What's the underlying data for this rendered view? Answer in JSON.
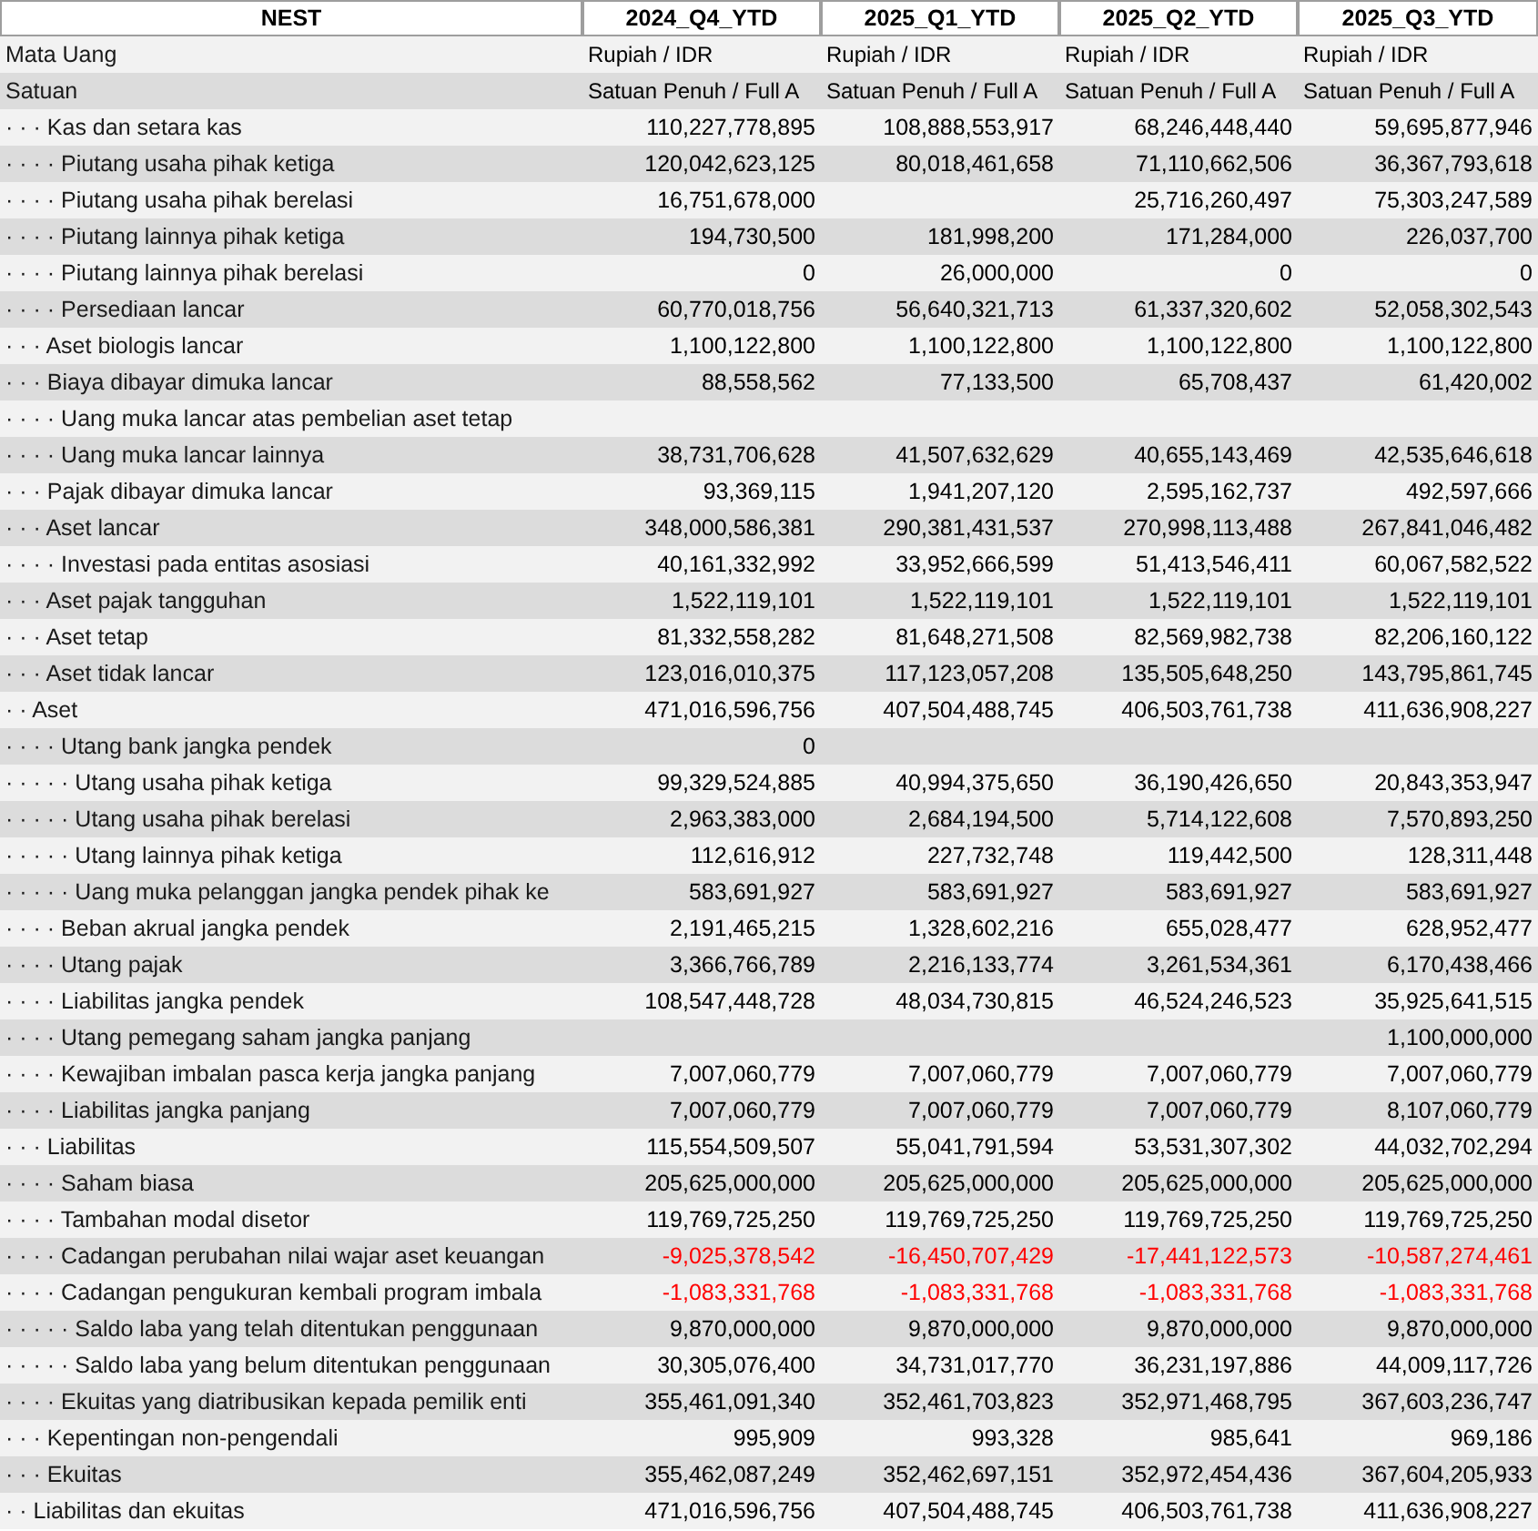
{
  "table": {
    "columns": [
      "NEST",
      "2024_Q4_YTD",
      "2025_Q1_YTD",
      "2025_Q2_YTD",
      "2025_Q3_YTD"
    ],
    "rows": [
      {
        "label": "Mata Uang",
        "kind": "meta",
        "q4_2024": "Rupiah / IDR",
        "q1_2025": "Rupiah / IDR",
        "q2_2025": "Rupiah / IDR",
        "q3_2025": "Rupiah / IDR"
      },
      {
        "label": "Satuan",
        "kind": "meta",
        "q4_2024": "Satuan Penuh / Full A",
        "q1_2025": "Satuan Penuh / Full A",
        "q2_2025": "Satuan Penuh / Full A",
        "q3_2025": "Satuan Penuh / Full A"
      },
      {
        "label": "· · · Kas dan setara kas",
        "negative": false,
        "kind": "num",
        "q4_2024": "110,227,778,895",
        "q1_2025": "108,888,553,917",
        "q2_2025": "68,246,448,440",
        "q3_2025": "59,695,877,946"
      },
      {
        "label": "· · · · Piutang usaha pihak ketiga",
        "negative": false,
        "kind": "num",
        "q4_2024": "120,042,623,125",
        "q1_2025": "80,018,461,658",
        "q2_2025": "71,110,662,506",
        "q3_2025": "36,367,793,618"
      },
      {
        "label": "· · · · Piutang usaha pihak berelasi",
        "negative": false,
        "kind": "num",
        "q4_2024": "16,751,678,000",
        "q2_2025": "25,716,260,497",
        "q3_2025": "75,303,247,589"
      },
      {
        "label": "· · · · Piutang lainnya pihak ketiga",
        "negative": false,
        "kind": "num",
        "q4_2024": "194,730,500",
        "q1_2025": "181,998,200",
        "q2_2025": "171,284,000",
        "q3_2025": "226,037,700"
      },
      {
        "label": "· · · · Piutang lainnya pihak berelasi",
        "negative": false,
        "kind": "num",
        "q4_2024": "0",
        "q1_2025": "26,000,000",
        "q2_2025": "0",
        "q3_2025": "0"
      },
      {
        "label": "· · · · Persediaan lancar",
        "negative": false,
        "kind": "num",
        "q4_2024": "60,770,018,756",
        "q1_2025": "56,640,321,713",
        "q2_2025": "61,337,320,602",
        "q3_2025": "52,058,302,543"
      },
      {
        "label": "· · · Aset biologis lancar",
        "negative": false,
        "kind": "num",
        "q4_2024": "1,100,122,800",
        "q1_2025": "1,100,122,800",
        "q2_2025": "1,100,122,800",
        "q3_2025": "1,100,122,800"
      },
      {
        "label": "· · · Biaya dibayar dimuka lancar",
        "negative": false,
        "kind": "num",
        "q4_2024": "88,558,562",
        "q1_2025": "77,133,500",
        "q2_2025": "65,708,437",
        "q3_2025": "61,420,002"
      },
      {
        "label": "· · · · Uang muka lancar atas pembelian aset tetap",
        "kind": "num"
      },
      {
        "label": "· · · · Uang muka lancar lainnya",
        "negative": false,
        "kind": "num",
        "q4_2024": "38,731,706,628",
        "q1_2025": "41,507,632,629",
        "q2_2025": "40,655,143,469",
        "q3_2025": "42,535,646,618"
      },
      {
        "label": "· · · Pajak dibayar dimuka lancar",
        "negative": false,
        "kind": "num",
        "q4_2024": "93,369,115",
        "q1_2025": "1,941,207,120",
        "q2_2025": "2,595,162,737",
        "q3_2025": "492,597,666"
      },
      {
        "label": "· · · Aset lancar",
        "negative": false,
        "kind": "num",
        "q4_2024": "348,000,586,381",
        "q1_2025": "290,381,431,537",
        "q2_2025": "270,998,113,488",
        "q3_2025": "267,841,046,482"
      },
      {
        "label": "· · · · Investasi pada entitas asosiasi",
        "negative": false,
        "kind": "num",
        "q4_2024": "40,161,332,992",
        "q1_2025": "33,952,666,599",
        "q2_2025": "51,413,546,411",
        "q3_2025": "60,067,582,522"
      },
      {
        "label": "· · · Aset pajak tangguhan",
        "negative": false,
        "kind": "num",
        "q4_2024": "1,522,119,101",
        "q1_2025": "1,522,119,101",
        "q2_2025": "1,522,119,101",
        "q3_2025": "1,522,119,101"
      },
      {
        "label": "· · · Aset tetap",
        "negative": false,
        "kind": "num",
        "q4_2024": "81,332,558,282",
        "q1_2025": "81,648,271,508",
        "q2_2025": "82,569,982,738",
        "q3_2025": "82,206,160,122"
      },
      {
        "label": "· · · Aset tidak lancar",
        "negative": false,
        "kind": "num",
        "q4_2024": "123,016,010,375",
        "q1_2025": "117,123,057,208",
        "q2_2025": "135,505,648,250",
        "q3_2025": "143,795,861,745"
      },
      {
        "label": "· · Aset",
        "negative": false,
        "kind": "num",
        "q4_2024": "471,016,596,756",
        "q1_2025": "407,504,488,745",
        "q2_2025": "406,503,761,738",
        "q3_2025": "411,636,908,227"
      },
      {
        "label": "· · · · Utang bank jangka pendek",
        "negative": false,
        "kind": "num",
        "q4_2024": "0"
      },
      {
        "label": "· · · · · Utang usaha pihak ketiga",
        "negative": false,
        "kind": "num",
        "q4_2024": "99,329,524,885",
        "q1_2025": "40,994,375,650",
        "q2_2025": "36,190,426,650",
        "q3_2025": "20,843,353,947"
      },
      {
        "label": "· · · · · Utang usaha pihak berelasi",
        "negative": false,
        "kind": "num",
        "q4_2024": "2,963,383,000",
        "q1_2025": "2,684,194,500",
        "q2_2025": "5,714,122,608",
        "q3_2025": "7,570,893,250"
      },
      {
        "label": "· · · · · Utang lainnya pihak ketiga",
        "negative": false,
        "kind": "num",
        "q4_2024": "112,616,912",
        "q1_2025": "227,732,748",
        "q2_2025": "119,442,500",
        "q3_2025": "128,311,448"
      },
      {
        "label": "· · · · · Uang muka pelanggan jangka pendek pihak ke",
        "negative": false,
        "kind": "num",
        "q4_2024": "583,691,927",
        "q1_2025": "583,691,927",
        "q2_2025": "583,691,927",
        "q3_2025": "583,691,927"
      },
      {
        "label": "· · · · Beban akrual jangka pendek",
        "negative": false,
        "kind": "num",
        "q4_2024": "2,191,465,215",
        "q1_2025": "1,328,602,216",
        "q2_2025": "655,028,477",
        "q3_2025": "628,952,477"
      },
      {
        "label": "· · · · Utang pajak",
        "negative": false,
        "kind": "num",
        "q4_2024": "3,366,766,789",
        "q1_2025": "2,216,133,774",
        "q2_2025": "3,261,534,361",
        "q3_2025": "6,170,438,466"
      },
      {
        "label": "· · · · Liabilitas jangka pendek",
        "negative": false,
        "kind": "num",
        "q4_2024": "108,547,448,728",
        "q1_2025": "48,034,730,815",
        "q2_2025": "46,524,246,523",
        "q3_2025": "35,925,641,515"
      },
      {
        "label": "· · · · Utang pemegang saham jangka panjang",
        "negative": false,
        "kind": "num",
        "q3_2025": "1,100,000,000"
      },
      {
        "label": "· · · · Kewajiban imbalan pasca kerja jangka panjang",
        "negative": false,
        "kind": "num",
        "q4_2024": "7,007,060,779",
        "q1_2025": "7,007,060,779",
        "q2_2025": "7,007,060,779",
        "q3_2025": "7,007,060,779"
      },
      {
        "label": "· · · · Liabilitas jangka panjang",
        "negative": false,
        "kind": "num",
        "q4_2024": "7,007,060,779",
        "q1_2025": "7,007,060,779",
        "q2_2025": "7,007,060,779",
        "q3_2025": "8,107,060,779"
      },
      {
        "label": "· · · Liabilitas",
        "negative": false,
        "kind": "num",
        "q4_2024": "115,554,509,507",
        "q1_2025": "55,041,791,594",
        "q2_2025": "53,531,307,302",
        "q3_2025": "44,032,702,294"
      },
      {
        "label": "· · · · Saham biasa",
        "negative": false,
        "kind": "num",
        "q4_2024": "205,625,000,000",
        "q1_2025": "205,625,000,000",
        "q2_2025": "205,625,000,000",
        "q3_2025": "205,625,000,000"
      },
      {
        "label": "· · · · Tambahan modal disetor",
        "negative": false,
        "kind": "num",
        "q4_2024": "119,769,725,250",
        "q1_2025": "119,769,725,250",
        "q2_2025": "119,769,725,250",
        "q3_2025": "119,769,725,250"
      },
      {
        "label": "· · · · Cadangan perubahan nilai wajar aset keuangan",
        "negative": true,
        "kind": "num",
        "q4_2024": "-9,025,378,542",
        "q1_2025": "-16,450,707,429",
        "q2_2025": "-17,441,122,573",
        "q3_2025": "-10,587,274,461"
      },
      {
        "label": "· · · · Cadangan pengukuran kembali program imbala",
        "negative": true,
        "kind": "num",
        "q4_2024": "-1,083,331,768",
        "q1_2025": "-1,083,331,768",
        "q2_2025": "-1,083,331,768",
        "q3_2025": "-1,083,331,768"
      },
      {
        "label": "· · · · · Saldo laba yang telah ditentukan penggunaan",
        "negative": false,
        "kind": "num",
        "q4_2024": "9,870,000,000",
        "q1_2025": "9,870,000,000",
        "q2_2025": "9,870,000,000",
        "q3_2025": "9,870,000,000"
      },
      {
        "label": "· · · · · Saldo laba yang belum ditentukan penggunaan",
        "negative": false,
        "kind": "num",
        "q4_2024": "30,305,076,400",
        "q1_2025": "34,731,017,770",
        "q2_2025": "36,231,197,886",
        "q3_2025": "44,009,117,726"
      },
      {
        "label": "· · · · Ekuitas yang diatribusikan kepada pemilik enti",
        "negative": false,
        "kind": "num",
        "q4_2024": "355,461,091,340",
        "q1_2025": "352,461,703,823",
        "q2_2025": "352,971,468,795",
        "q3_2025": "367,603,236,747"
      },
      {
        "label": "· · · Kepentingan non-pengendali",
        "negative": false,
        "kind": "num",
        "q4_2024": "995,909",
        "q1_2025": "993,328",
        "q2_2025": "985,641",
        "q3_2025": "969,186"
      },
      {
        "label": "· · · Ekuitas",
        "negative": false,
        "kind": "num",
        "q4_2024": "355,462,087,249",
        "q1_2025": "352,462,697,151",
        "q2_2025": "352,972,454,436",
        "q3_2025": "367,604,205,933"
      },
      {
        "label": "· · Liabilitas dan ekuitas",
        "negative": false,
        "kind": "num",
        "q4_2024": "471,016,596,756",
        "q1_2025": "407,504,488,745",
        "q2_2025": "406,503,761,738",
        "q3_2025": "411,636,908,227"
      }
    ]
  }
}
